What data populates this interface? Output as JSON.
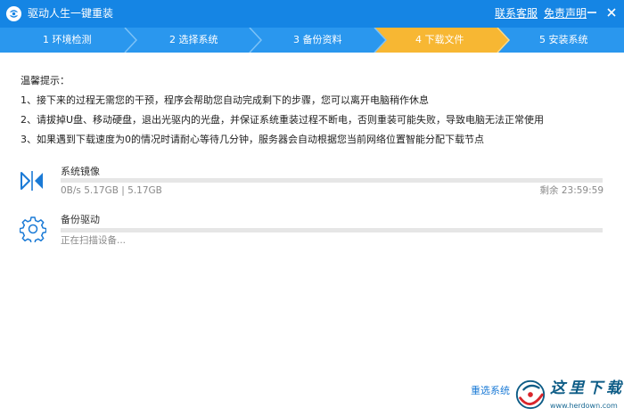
{
  "app": {
    "title": "驱动人生一键重装"
  },
  "header": {
    "service_link": "联系客服",
    "disclaimer_link": "免责声明",
    "minimize_icon": "minimize-icon",
    "close_icon": "close-icon"
  },
  "colors": {
    "brand_blue": "#1585e4",
    "step_done": "#2a97ee",
    "step_active": "#f7b733",
    "step_pending": "#2a97ee"
  },
  "steps": [
    {
      "label": "1 环境检测",
      "state": "done"
    },
    {
      "label": "2 选择系统",
      "state": "done"
    },
    {
      "label": "3 备份资料",
      "state": "done"
    },
    {
      "label": "4 下载文件",
      "state": "active"
    },
    {
      "label": "5 安装系统",
      "state": "pending"
    }
  ],
  "tips": {
    "title": "温馨提示：",
    "items": [
      "1、接下来的过程无需您的干预，程序会帮助您自动完成剩下的步骤，您可以离开电脑稍作休息",
      "2、请拔掉U盘、移动硬盘，退出光驱内的光盘，并保证系统重装过程不断电，否则重装可能失败，导致电脑无法正常使用",
      "3、如果遇到下载速度为0的情况时请耐心等待几分钟，服务器会自动根据您当前网络位置智能分配下载节点"
    ]
  },
  "tasks": [
    {
      "icon": "download-arrows-icon",
      "name": "系统镜像",
      "status": "0B/s 5.17GB | 5.17GB",
      "remaining": "剩余 23:59:59",
      "progress": 0
    },
    {
      "icon": "gear-icon",
      "name": "备份驱动",
      "status": "正在扫描设备...",
      "progress": 0
    }
  ],
  "footer": {
    "reselect_label": "重选系统"
  },
  "watermark": {
    "text": "这里下载",
    "url": "www.herdown.com"
  }
}
